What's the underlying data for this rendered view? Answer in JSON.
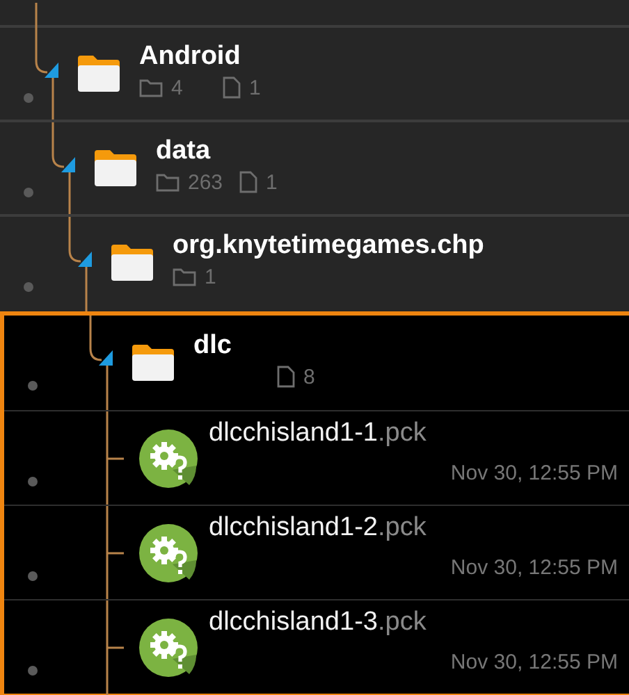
{
  "tree": [
    {
      "kind": "folder",
      "name": "Android",
      "folders": "4",
      "files": "1",
      "selected": false,
      "children": [
        {
          "kind": "folder",
          "name": "data",
          "folders": "263",
          "files": "1",
          "selected": false,
          "children": [
            {
              "kind": "folder",
              "name": "org.knytetimegames.chp",
              "folders": "1",
              "selected": false,
              "children": [
                {
                  "kind": "folder",
                  "name": "dlc",
                  "files": "8",
                  "selected": true,
                  "children": [
                    {
                      "kind": "file",
                      "name": "dlcchisland1-1",
                      "ext": ".pck",
                      "date": "Nov 30, 12:55 PM"
                    },
                    {
                      "kind": "file",
                      "name": "dlcchisland1-2",
                      "ext": ".pck",
                      "date": "Nov 30, 12:55 PM"
                    },
                    {
                      "kind": "file",
                      "name": "dlcchisland1-3",
                      "ext": ".pck",
                      "date": "Nov 30, 12:55 PM"
                    }
                  ]
                }
              ]
            }
          ]
        }
      ]
    }
  ]
}
